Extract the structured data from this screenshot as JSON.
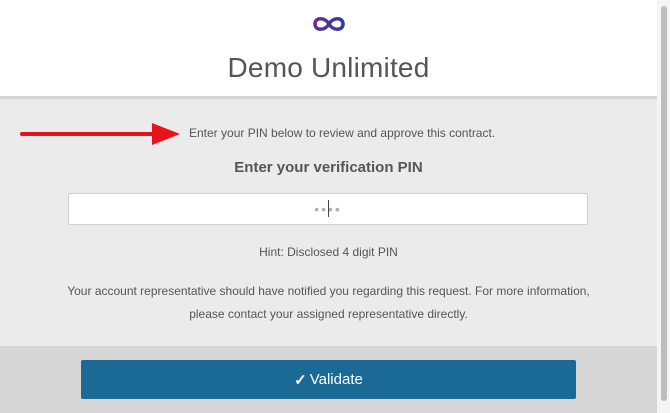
{
  "header": {
    "logo_icon": "infinity-logo",
    "brand": "Demo Unlimited"
  },
  "main": {
    "instruction": "Enter your PIN below to review and approve this contract.",
    "subtitle": "Enter your verification PIN",
    "pin_input": {
      "value": "",
      "placeholder": "••••"
    },
    "hint": "Hint: Disclosed 4 digit PIN",
    "info": "Your account representative should have notified you regarding this request. For more information, please contact your assigned representative directly."
  },
  "annotation": {
    "arrow_icon": "arrow-right-icon",
    "color": "#e8131a"
  },
  "footer": {
    "validate_label": "Validate",
    "validate_icon": "check-icon",
    "button_color": "#1b6a96"
  }
}
